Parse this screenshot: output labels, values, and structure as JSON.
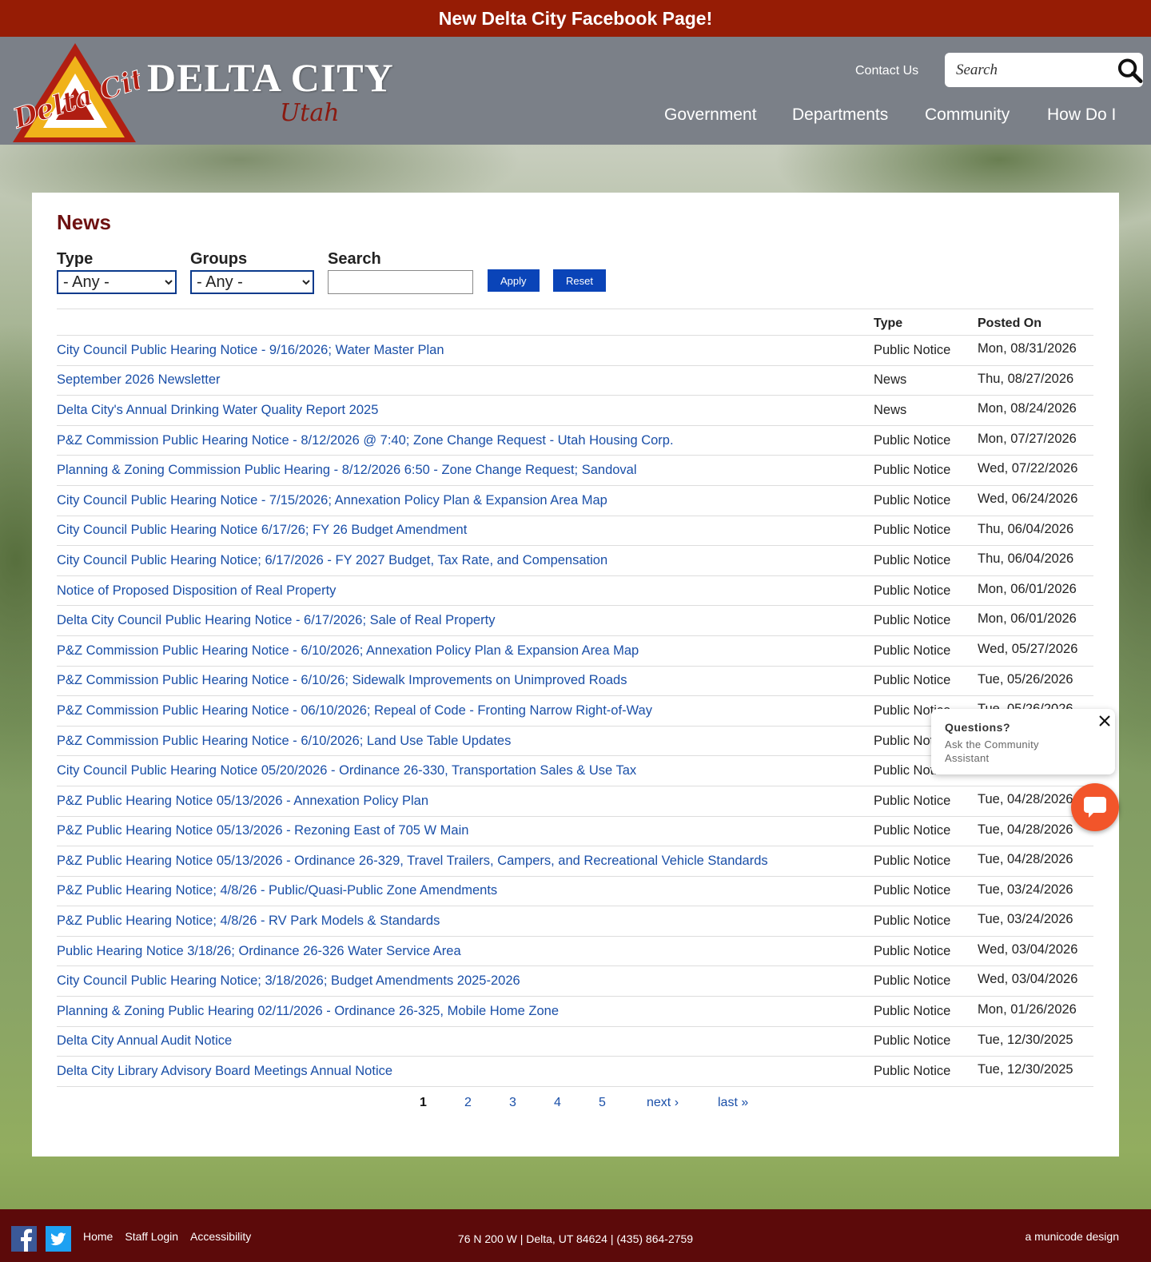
{
  "banner": {
    "text": "New Delta City Facebook Page!"
  },
  "header": {
    "logo_title": "DELTA CITY",
    "logo_sub": "Utah",
    "logo_mark_text": "Delta City",
    "contact_label": "Contact Us",
    "search_placeholder": "Search",
    "nav": [
      "Government",
      "Departments",
      "Community",
      "How Do I"
    ]
  },
  "page": {
    "title": "News",
    "filters": {
      "type_label": "Type",
      "type_value": "- Any -",
      "groups_label": "Groups",
      "groups_value": "- Any -",
      "search_label": "Search",
      "search_value": "",
      "apply_label": "Apply",
      "reset_label": "Reset"
    },
    "table": {
      "headers": [
        "",
        "Type",
        "Posted On"
      ],
      "rows": [
        {
          "title": "City Council Public Hearing Notice - 9/16/2026; Water Master Plan",
          "type": "Public Notice",
          "date": "Mon, 08/31/2026"
        },
        {
          "title": "September 2026 Newsletter",
          "type": "News",
          "date": "Thu, 08/27/2026"
        },
        {
          "title": "Delta City's Annual Drinking Water Quality Report 2025",
          "type": "News",
          "date": "Mon, 08/24/2026"
        },
        {
          "title": "P&Z Commission Public Hearing Notice - 8/12/2026 @ 7:40; Zone Change Request - Utah Housing Corp.",
          "type": "Public Notice",
          "date": "Mon, 07/27/2026"
        },
        {
          "title": "Planning & Zoning Commission Public Hearing - 8/12/2026 6:50 - Zone Change Request; Sandoval",
          "type": "Public Notice",
          "date": "Wed, 07/22/2026"
        },
        {
          "title": "City Council Public Hearing Notice - 7/15/2026; Annexation Policy Plan & Expansion Area Map",
          "type": "Public Notice",
          "date": "Wed, 06/24/2026"
        },
        {
          "title": "City Council Public Hearing Notice 6/17/26; FY 26 Budget Amendment",
          "type": "Public Notice",
          "date": "Thu, 06/04/2026"
        },
        {
          "title": "City Council Public Hearing Notice; 6/17/2026 - FY 2027 Budget, Tax Rate, and Compensation",
          "type": "Public Notice",
          "date": "Thu, 06/04/2026"
        },
        {
          "title": "Notice of Proposed Disposition of Real Property",
          "type": "Public Notice",
          "date": "Mon, 06/01/2026"
        },
        {
          "title": "Delta City Council Public Hearing Notice - 6/17/2026; Sale of Real Property",
          "type": "Public Notice",
          "date": "Mon, 06/01/2026"
        },
        {
          "title": "P&Z Commission Public Hearing Notice - 6/10/2026; Annexation Policy Plan & Expansion Area Map",
          "type": "Public Notice",
          "date": "Wed, 05/27/2026"
        },
        {
          "title": "P&Z Commission Public Hearing Notice - 6/10/26; Sidewalk Improvements on Unimproved Roads",
          "type": "Public Notice",
          "date": "Tue, 05/26/2026"
        },
        {
          "title": "P&Z Commission Public Hearing Notice - 06/10/2026; Repeal of Code - Fronting Narrow Right-of-Way",
          "type": "Public Notice",
          "date": "Tue, 05/26/2026"
        },
        {
          "title": "P&Z Commission Public Hearing Notice - 6/10/2026; Land Use Table Updates",
          "type": "Public Notice",
          "date": ""
        },
        {
          "title": "City Council Public Hearing Notice 05/20/2026 - Ordinance 26-330, Transportation Sales & Use Tax",
          "type": "Public Notice",
          "date": ""
        },
        {
          "title": "P&Z Public Hearing Notice 05/13/2026 - Annexation Policy Plan",
          "type": "Public Notice",
          "date": "Tue, 04/28/2026"
        },
        {
          "title": "P&Z Public Hearing Notice 05/13/2026 - Rezoning East of 705 W Main",
          "type": "Public Notice",
          "date": "Tue, 04/28/2026"
        },
        {
          "title": "P&Z Public Hearing Notice 05/13/2026 - Ordinance 26-329, Travel Trailers, Campers, and Recreational Vehicle Standards",
          "type": "Public Notice",
          "date": "Tue, 04/28/2026"
        },
        {
          "title": "P&Z Public Hearing Notice; 4/8/26 - Public/Quasi-Public Zone Amendments",
          "type": "Public Notice",
          "date": "Tue, 03/24/2026"
        },
        {
          "title": "P&Z Public Hearing Notice; 4/8/26 - RV Park Models & Standards",
          "type": "Public Notice",
          "date": "Tue, 03/24/2026"
        },
        {
          "title": "Public Hearing Notice 3/18/26; Ordinance 26-326 Water Service Area",
          "type": "Public Notice",
          "date": "Wed, 03/04/2026"
        },
        {
          "title": "City Council Public Hearing Notice; 3/18/2026; Budget Amendments 2025-2026",
          "type": "Public Notice",
          "date": "Wed, 03/04/2026"
        },
        {
          "title": "Planning & Zoning Public Hearing 02/11/2026 - Ordinance 26-325, Mobile Home Zone",
          "type": "Public Notice",
          "date": "Mon, 01/26/2026"
        },
        {
          "title": "Delta City Annual Audit Notice",
          "type": "Public Notice",
          "date": "Tue, 12/30/2025"
        },
        {
          "title": "Delta City Library Advisory Board Meetings Annual Notice",
          "type": "Public Notice",
          "date": "Tue, 12/30/2025"
        }
      ]
    },
    "pager": {
      "current": "1",
      "pages": [
        "2",
        "3",
        "4",
        "5"
      ],
      "next_label": "next ›",
      "last_label": "last »"
    }
  },
  "chat": {
    "question": "Questions?",
    "prompt": "Ask the Community Assistant",
    "close_label": "X"
  },
  "footer": {
    "links": [
      "Home",
      "Staff Login",
      "Accessibility"
    ],
    "address": "76 N 200 W | Delta, UT 84624 | (435) 864-2759",
    "credit": "a municode design"
  },
  "colors": {
    "banner": "#961c05",
    "header": "#7b8088",
    "title": "#6e1212",
    "link": "#1a4fa8",
    "button": "#0a44b8",
    "footer": "#5c0a0a",
    "chat": "#f2552a"
  },
  "icons": [
    "search-icon",
    "facebook-icon",
    "twitter-icon",
    "chat-icon",
    "close-icon",
    "delta-city-logo-icon"
  ]
}
